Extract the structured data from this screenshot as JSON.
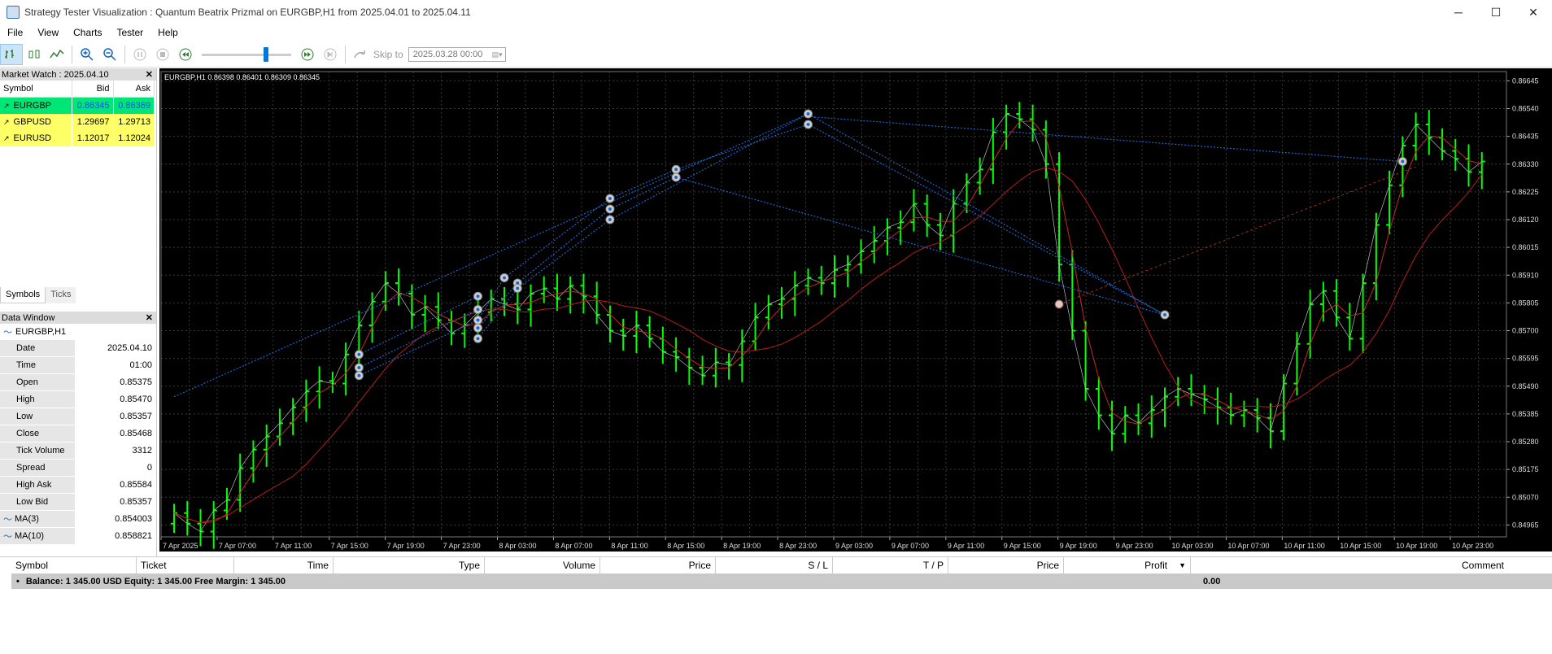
{
  "window": {
    "title": "Strategy Tester Visualization : Quantum Beatrix Prizmal on EURGBP,H1 from 2025.04.01 to 2025.04.11",
    "min": "─",
    "max": "☐",
    "close": "✕"
  },
  "menu": [
    "File",
    "View",
    "Charts",
    "Tester",
    "Help"
  ],
  "toolbar": {
    "skip_label": "Skip to",
    "skip_date": "2025.03.28 00:00"
  },
  "market_watch": {
    "title": "Market Watch : 2025.04.10",
    "columns": [
      "Symbol",
      "Bid",
      "Ask"
    ],
    "rows": [
      {
        "symbol": "EURGBP",
        "bid": "0.86345",
        "ask": "0.86369",
        "bg": "#00e676",
        "bidColor": "#0057e7",
        "askColor": "#0057e7"
      },
      {
        "symbol": "GBPUSD",
        "bid": "1.29697",
        "ask": "1.29713",
        "bg": "#ffff66",
        "bidColor": "#000",
        "askColor": "#000"
      },
      {
        "symbol": "EURUSD",
        "bid": "1.12017",
        "ask": "1.12024",
        "bg": "#ffff66",
        "bidColor": "#000",
        "askColor": "#000"
      }
    ],
    "tabs": [
      "Symbols",
      "Ticks"
    ]
  },
  "data_window": {
    "title": "Data Window",
    "symbol": "EURGBP,H1",
    "rows": [
      {
        "k": "Date",
        "v": "2025.04.10"
      },
      {
        "k": "Time",
        "v": "01:00"
      },
      {
        "k": "Open",
        "v": "0.85375"
      },
      {
        "k": "High",
        "v": "0.85470"
      },
      {
        "k": "Low",
        "v": "0.85357"
      },
      {
        "k": "Close",
        "v": "0.85468"
      },
      {
        "k": "Tick Volume",
        "v": "3312"
      },
      {
        "k": "Spread",
        "v": "0"
      },
      {
        "k": "High Ask",
        "v": "0.85584"
      },
      {
        "k": "Low Bid",
        "v": "0.85357"
      },
      {
        "k": "MA(3)",
        "v": "0.854003"
      },
      {
        "k": "MA(10)",
        "v": "0.858821"
      }
    ]
  },
  "chart": {
    "header": "EURGBP,H1  0.86398 0.86401 0.86309 0.86345",
    "y_ticks": [
      "0.86645",
      "0.86540",
      "0.86435",
      "0.86330",
      "0.86225",
      "0.86120",
      "0.86015",
      "0.85910",
      "0.85805",
      "0.85700",
      "0.85595",
      "0.85490",
      "0.85385",
      "0.85280",
      "0.85175",
      "0.85070",
      "0.84965"
    ],
    "x_ticks": [
      "7 Apr 2025",
      "7 Apr 07:00",
      "7 Apr 11:00",
      "7 Apr 15:00",
      "7 Apr 19:00",
      "7 Apr 23:00",
      "8 Apr 03:00",
      "8 Apr 07:00",
      "8 Apr 11:00",
      "8 Apr 15:00",
      "8 Apr 19:00",
      "8 Apr 23:00",
      "9 Apr 03:00",
      "9 Apr 07:00",
      "9 Apr 11:00",
      "9 Apr 15:00",
      "9 Apr 19:00",
      "9 Apr 23:00",
      "10 Apr 03:00",
      "10 Apr 07:00",
      "10 Apr 11:00",
      "10 Apr 15:00",
      "10 Apr 19:00",
      "10 Apr 23:00"
    ]
  },
  "chart_data": {
    "type": "bar",
    "ylim": [
      0.8492,
      0.8668
    ],
    "closes": [
      0.8501,
      0.8497,
      0.8494,
      0.8502,
      0.8506,
      0.8518,
      0.8525,
      0.853,
      0.8535,
      0.8541,
      0.8547,
      0.8551,
      0.855,
      0.8561,
      0.8572,
      0.8581,
      0.8588,
      0.8584,
      0.8576,
      0.8579,
      0.8574,
      0.8569,
      0.8572,
      0.8577,
      0.8582,
      0.858,
      0.8578,
      0.8584,
      0.8586,
      0.8582,
      0.8587,
      0.8583,
      0.8576,
      0.857,
      0.8568,
      0.8572,
      0.8567,
      0.8562,
      0.856,
      0.8556,
      0.8553,
      0.8558,
      0.8557,
      0.8566,
      0.8575,
      0.858,
      0.8582,
      0.8587,
      0.859,
      0.8588,
      0.8593,
      0.8595,
      0.86,
      0.8604,
      0.8609,
      0.8611,
      0.8618,
      0.861,
      0.8606,
      0.8618,
      0.8626,
      0.8631,
      0.8645,
      0.8652,
      0.865,
      0.8646,
      0.8633,
      0.8595,
      0.857,
      0.8548,
      0.8538,
      0.8531,
      0.8538,
      0.8535,
      0.854,
      0.8545,
      0.8548,
      0.8546,
      0.8544,
      0.8541,
      0.8538,
      0.854,
      0.8537,
      0.8532,
      0.855,
      0.8565,
      0.858,
      0.8585,
      0.8575,
      0.8567,
      0.8588,
      0.861,
      0.8625,
      0.864,
      0.8648,
      0.8643,
      0.8638,
      0.8635,
      0.863,
      0.8634
    ],
    "markers": [
      {
        "i": 14,
        "p": 0.8561
      },
      {
        "i": 14,
        "p": 0.8556
      },
      {
        "i": 14,
        "p": 0.8553
      },
      {
        "i": 23,
        "p": 0.8583
      },
      {
        "i": 23,
        "p": 0.8578
      },
      {
        "i": 23,
        "p": 0.8574
      },
      {
        "i": 23,
        "p": 0.8571
      },
      {
        "i": 23,
        "p": 0.8567
      },
      {
        "i": 25,
        "p": 0.859
      },
      {
        "i": 26,
        "p": 0.8588
      },
      {
        "i": 26,
        "p": 0.8586
      },
      {
        "i": 33,
        "p": 0.862
      },
      {
        "i": 33,
        "p": 0.8616
      },
      {
        "i": 33,
        "p": 0.8612
      },
      {
        "i": 38,
        "p": 0.8631
      },
      {
        "i": 38,
        "p": 0.8628
      },
      {
        "i": 48,
        "p": 0.8652
      },
      {
        "i": 48,
        "p": 0.8648
      },
      {
        "i": 75,
        "p": 0.8576
      },
      {
        "i": 93,
        "p": 0.8634
      }
    ]
  },
  "orders": {
    "columns": [
      "Symbol",
      "Ticket",
      "Time",
      "Type",
      "Volume",
      "Price",
      "S / L",
      "T / P",
      "Price",
      "Profit",
      "Comment"
    ],
    "balance_text": "Balance: 1 345.00 USD  Equity: 1 345.00  Free Margin: 1 345.00",
    "profit": "0.00"
  }
}
